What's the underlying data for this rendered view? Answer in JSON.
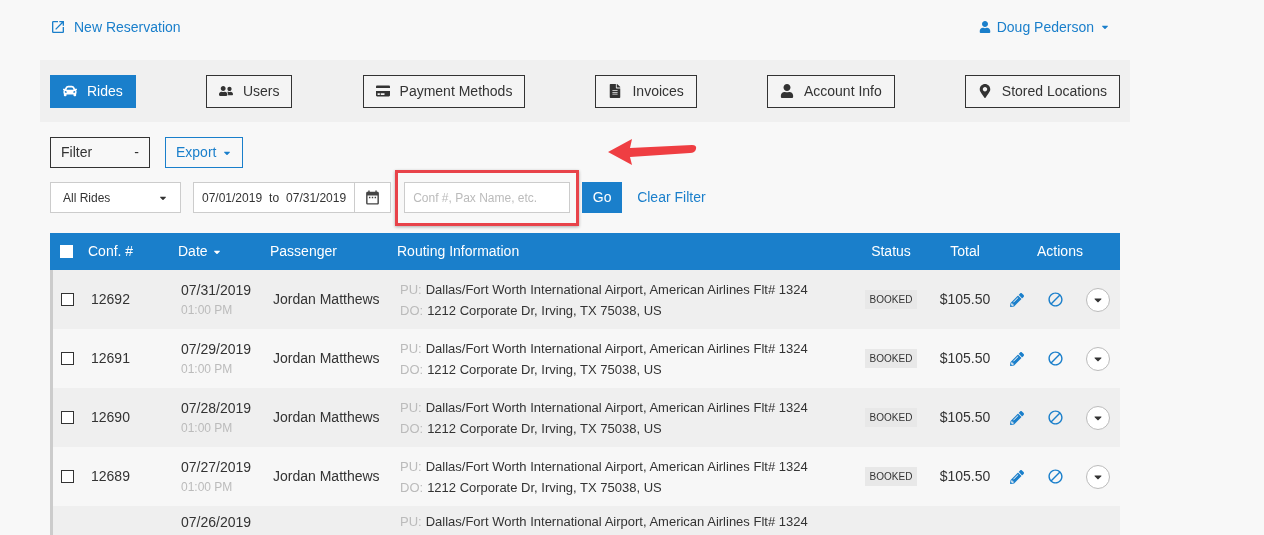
{
  "header": {
    "new_reservation": "New Reservation",
    "user_name": "Doug Pederson"
  },
  "tabs": [
    {
      "label": "Rides",
      "kind": "car",
      "selected": true
    },
    {
      "label": "Users",
      "kind": "users",
      "selected": false
    },
    {
      "label": "Payment Methods",
      "kind": "card",
      "selected": false
    },
    {
      "label": "Invoices",
      "kind": "file",
      "selected": false
    },
    {
      "label": "Account Info",
      "kind": "person",
      "selected": false
    },
    {
      "label": "Stored Locations",
      "kind": "pin",
      "selected": false
    }
  ],
  "toolbar": {
    "filter": "Filter",
    "filter_toggle": "-",
    "export": "Export"
  },
  "filters": {
    "ride_type": "All Rides",
    "date_from": "07/01/2019",
    "date_sep": "to",
    "date_to": "07/31/2019",
    "search_placeholder": "Conf #, Pax Name, etc.",
    "go": "Go",
    "clear": "Clear Filter"
  },
  "table": {
    "select_all_checked": false,
    "columns": [
      "Conf. #",
      "Date",
      "Passenger",
      "Routing Information",
      "Status",
      "Total",
      "Actions"
    ],
    "rows": [
      {
        "checked": false,
        "conf": "12692",
        "date": "07/31/2019",
        "time": "01:00 PM",
        "passenger": "Jordan Matthews",
        "pu_label": "PU:",
        "pu": "Dallas/Fort Worth International Airport, American Airlines Flt# 1324",
        "do_label": "DO:",
        "do": "1212 Corporate Dr, Irving, TX 75038, US",
        "status": "BOOKED",
        "total": "$105.50"
      },
      {
        "checked": false,
        "conf": "12691",
        "date": "07/29/2019",
        "time": "01:00 PM",
        "passenger": "Jordan Matthews",
        "pu_label": "PU:",
        "pu": "Dallas/Fort Worth International Airport, American Airlines Flt# 1324",
        "do_label": "DO:",
        "do": "1212 Corporate Dr, Irving, TX 75038, US",
        "status": "BOOKED",
        "total": "$105.50"
      },
      {
        "checked": false,
        "conf": "12690",
        "date": "07/28/2019",
        "time": "01:00 PM",
        "passenger": "Jordan Matthews",
        "pu_label": "PU:",
        "pu": "Dallas/Fort Worth International Airport, American Airlines Flt# 1324",
        "do_label": "DO:",
        "do": "1212 Corporate Dr, Irving, TX 75038, US",
        "status": "BOOKED",
        "total": "$105.50"
      },
      {
        "checked": false,
        "conf": "12689",
        "date": "07/27/2019",
        "time": "01:00 PM",
        "passenger": "Jordan Matthews",
        "pu_label": "PU:",
        "pu": "Dallas/Fort Worth International Airport, American Airlines Flt# 1324",
        "do_label": "DO:",
        "do": "1212 Corporate Dr, Irving, TX 75038, US",
        "status": "BOOKED",
        "total": "$105.50"
      }
    ],
    "partial_row": {
      "date": "07/26/2019",
      "pu_label": "PU:",
      "pu": "Dallas/Fort Worth International Airport, American Airlines Flt# 1324"
    }
  }
}
